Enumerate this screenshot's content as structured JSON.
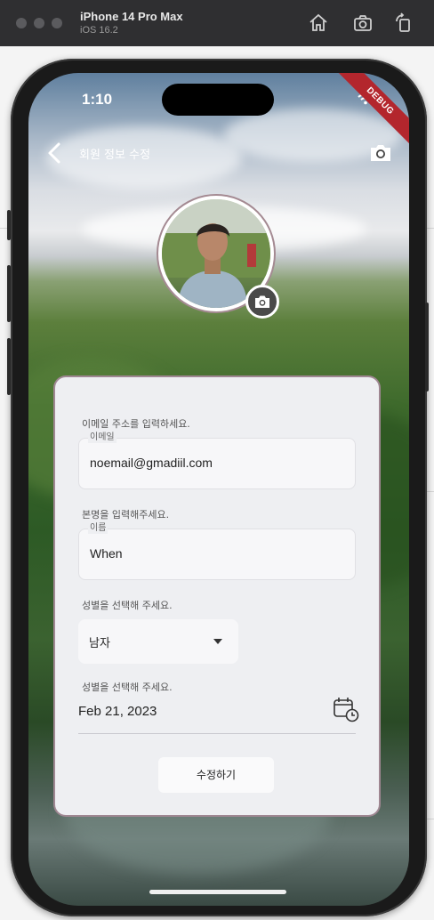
{
  "simulator": {
    "device": "iPhone 14 Pro Max",
    "os": "iOS 16.2",
    "icons": [
      "home-icon",
      "screenshot-icon",
      "rotate-icon"
    ]
  },
  "status_bar": {
    "time": "1:10",
    "debug_label": "DEBUG"
  },
  "appbar": {
    "title": "회원 정보 수정",
    "back_icon": "chevron-left-icon",
    "camera_icon": "camera-icon"
  },
  "profile": {
    "avatar_alt": "profile photo",
    "camera_icon": "camera-icon"
  },
  "form": {
    "email_section": "이메일 주소를 입력하세요.",
    "email_label": "이메일",
    "email_value": "noemail@gmadiil.com",
    "name_section": "본명을 입력해주세요.",
    "name_label": "이름",
    "name_value": "When",
    "gender_section": "성별을 선택해 주세요.",
    "gender_value": "남자",
    "date_section": "성별을 선택해 주세요.",
    "date_value": "Feb 21, 2023",
    "calendar_icon": "calendar-clock-icon",
    "submit_label": "수정하기"
  },
  "colors": {
    "card_border": "#9f8792",
    "debug_ribbon": "#b3262d"
  }
}
